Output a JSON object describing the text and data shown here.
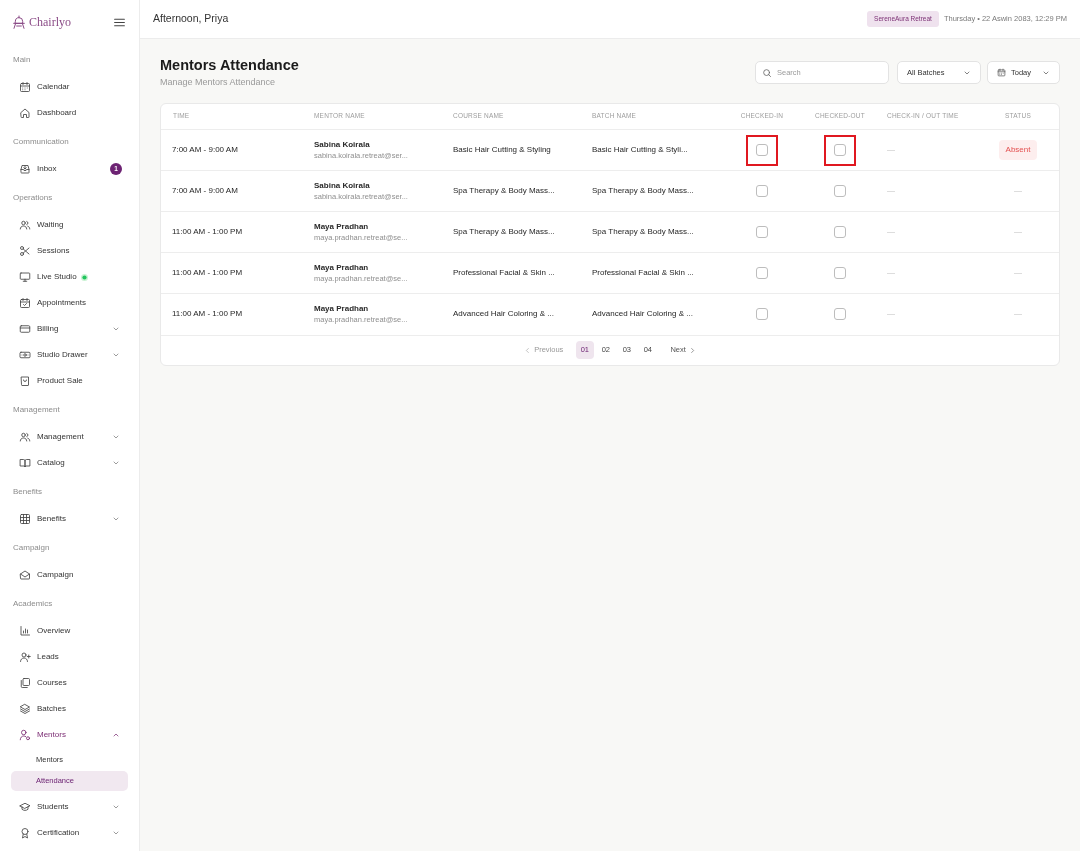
{
  "header": {
    "greeting": "Afternoon, Priya",
    "workspace": "SereneAura Retreat",
    "datetime": "Thursday • 22 Aswin 2083, 12:29 PM"
  },
  "sidebar": {
    "brand": "Chairlyo",
    "sections": [
      {
        "title": "Main",
        "items": [
          {
            "label": "Calendar",
            "kind": "link",
            "selected": false
          },
          {
            "label": "Dashboard",
            "kind": "link",
            "selected": false
          }
        ]
      },
      {
        "title": "Communication",
        "items": [
          {
            "label": "Inbox",
            "kind": "link",
            "selected": false,
            "badge": "1"
          }
        ]
      },
      {
        "title": "Operations",
        "items": [
          {
            "label": "Waiting",
            "kind": "link",
            "selected": false
          },
          {
            "label": "Sessions",
            "kind": "link",
            "selected": false
          },
          {
            "label": "Live Studio",
            "kind": "link",
            "selected": false,
            "live": true
          },
          {
            "label": "Appointments",
            "kind": "link",
            "selected": false
          },
          {
            "label": "Billing",
            "kind": "group",
            "selected": false,
            "expanded": false
          },
          {
            "label": "Studio Drawer",
            "kind": "group",
            "selected": false,
            "expanded": false
          },
          {
            "label": "Product Sale",
            "kind": "link",
            "selected": false
          }
        ]
      },
      {
        "title": "Management",
        "items": [
          {
            "label": "Management",
            "kind": "group",
            "selected": false,
            "expanded": false
          },
          {
            "label": "Catalog",
            "kind": "group",
            "selected": false,
            "expanded": false
          }
        ]
      },
      {
        "title": "Benefits",
        "items": [
          {
            "label": "Benefits",
            "kind": "group",
            "selected": false,
            "expanded": false
          }
        ]
      },
      {
        "title": "Campaign",
        "items": [
          {
            "label": "Campaign",
            "kind": "link",
            "selected": false
          }
        ]
      },
      {
        "title": "Academics",
        "items": [
          {
            "label": "Overview",
            "kind": "link",
            "selected": false
          },
          {
            "label": "Leads",
            "kind": "link",
            "selected": false
          },
          {
            "label": "Courses",
            "kind": "link",
            "selected": false
          },
          {
            "label": "Batches",
            "kind": "link",
            "selected": false
          },
          {
            "label": "Mentors",
            "kind": "group",
            "selected": true,
            "expanded": true,
            "children": [
              {
                "label": "Mentors",
                "selected": false
              },
              {
                "label": "Attendance",
                "selected": true
              }
            ]
          },
          {
            "label": "Students",
            "kind": "group",
            "selected": false,
            "expanded": false
          },
          {
            "label": "Certification",
            "kind": "group",
            "selected": false,
            "expanded": false
          }
        ]
      }
    ]
  },
  "page": {
    "title": "Mentors Attendance",
    "subtitle": "Manage Mentors Attendance"
  },
  "filters": {
    "search": {
      "placeholder": "Search"
    },
    "batch": "All Batches",
    "date": "Today"
  },
  "table": {
    "columns": [
      "TIME",
      "MENTOR NAME",
      "COURSE NAME",
      "BATCH NAME",
      "CHECKED-IN",
      "CHECKED-OUT",
      "CHECK-IN / OUT TIME",
      "STATUS"
    ],
    "rows": [
      {
        "time": "7:00 AM - 9:00 AM",
        "mentor_name": "Sabina Koirala",
        "mentor_email": "sabina.koirala.retreat@ser...",
        "course": "Basic Hair Cutting & Styling",
        "batch": "Basic Hair Cutting & Styli...",
        "checked_in": {
          "checked": false,
          "highlighted": true
        },
        "checked_out": {
          "checked": false,
          "highlighted": true
        },
        "check_time": "—",
        "status": {
          "label": "Absent",
          "kind": "absent"
        }
      },
      {
        "time": "7:00 AM - 9:00 AM",
        "mentor_name": "Sabina Koirala",
        "mentor_email": "sabina.koirala.retreat@ser...",
        "course": "Spa Therapy & Body Mass...",
        "batch": "Spa Therapy & Body Mass...",
        "checked_in": {
          "checked": false
        },
        "checked_out": {
          "checked": false
        },
        "check_time": "—",
        "status": {
          "label": "—",
          "kind": "none"
        }
      },
      {
        "time": "11:00 AM - 1:00 PM",
        "mentor_name": "Maya Pradhan",
        "mentor_email": "maya.pradhan.retreat@se...",
        "course": "Spa Therapy & Body Mass...",
        "batch": "Spa Therapy & Body Mass...",
        "checked_in": {
          "checked": false
        },
        "checked_out": {
          "checked": false
        },
        "check_time": "—",
        "status": {
          "label": "—",
          "kind": "none"
        }
      },
      {
        "time": "11:00 AM - 1:00 PM",
        "mentor_name": "Maya Pradhan",
        "mentor_email": "maya.pradhan.retreat@se...",
        "course": "Professional Facial & Skin ...",
        "batch": "Professional Facial & Skin ...",
        "checked_in": {
          "checked": false
        },
        "checked_out": {
          "checked": false
        },
        "check_time": "—",
        "status": {
          "label": "—",
          "kind": "none"
        }
      },
      {
        "time": "11:00 AM - 1:00 PM",
        "mentor_name": "Maya Pradhan",
        "mentor_email": "maya.pradhan.retreat@se...",
        "course": "Advanced Hair Coloring & ...",
        "batch": "Advanced Hair Coloring & ...",
        "checked_in": {
          "checked": false
        },
        "checked_out": {
          "checked": false
        },
        "check_time": "—",
        "status": {
          "label": "—",
          "kind": "none"
        }
      }
    ]
  },
  "pagination": {
    "previous": {
      "label": "Previous",
      "disabled": true
    },
    "pages": [
      {
        "label": "01",
        "selected": true
      },
      {
        "label": "02",
        "selected": false
      },
      {
        "label": "03",
        "selected": false
      },
      {
        "label": "04",
        "selected": false
      }
    ],
    "next": {
      "label": "Next",
      "disabled": false
    }
  }
}
